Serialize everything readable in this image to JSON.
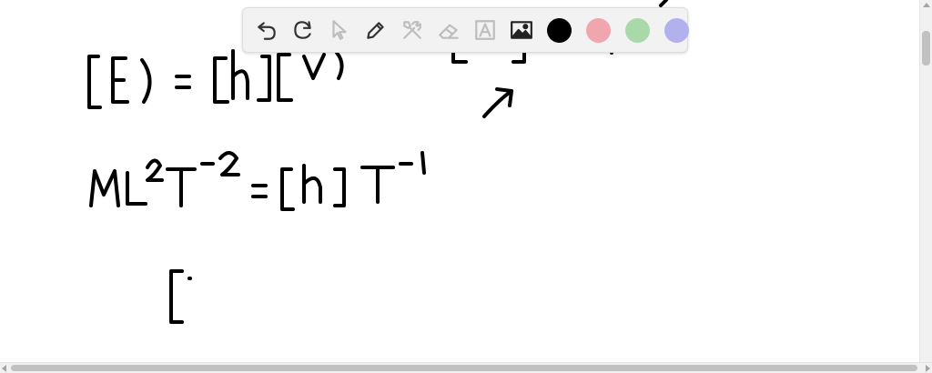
{
  "canvas": {
    "background": "#ffffff",
    "ink_color": "#000000"
  },
  "toolbar": {
    "tools": [
      {
        "id": "undo",
        "icon": "undo-icon",
        "state": "enabled"
      },
      {
        "id": "redo",
        "icon": "redo-icon",
        "state": "enabled"
      },
      {
        "id": "select",
        "icon": "pointer-icon",
        "state": "disabled"
      },
      {
        "id": "pen",
        "icon": "pen-icon",
        "state": "enabled"
      },
      {
        "id": "tools",
        "icon": "tools-icon",
        "state": "disabled"
      },
      {
        "id": "eraser",
        "icon": "eraser-icon",
        "state": "disabled"
      },
      {
        "id": "text",
        "icon": "text-box-icon",
        "state": "disabled"
      },
      {
        "id": "image",
        "icon": "image-icon",
        "state": "enabled"
      }
    ],
    "colors": [
      {
        "name": "black",
        "hex": "#000000"
      },
      {
        "name": "red",
        "hex": "#f0a6ae"
      },
      {
        "name": "green",
        "hex": "#a9d8a9"
      },
      {
        "name": "purple",
        "hex": "#b3b0ee"
      }
    ]
  }
}
